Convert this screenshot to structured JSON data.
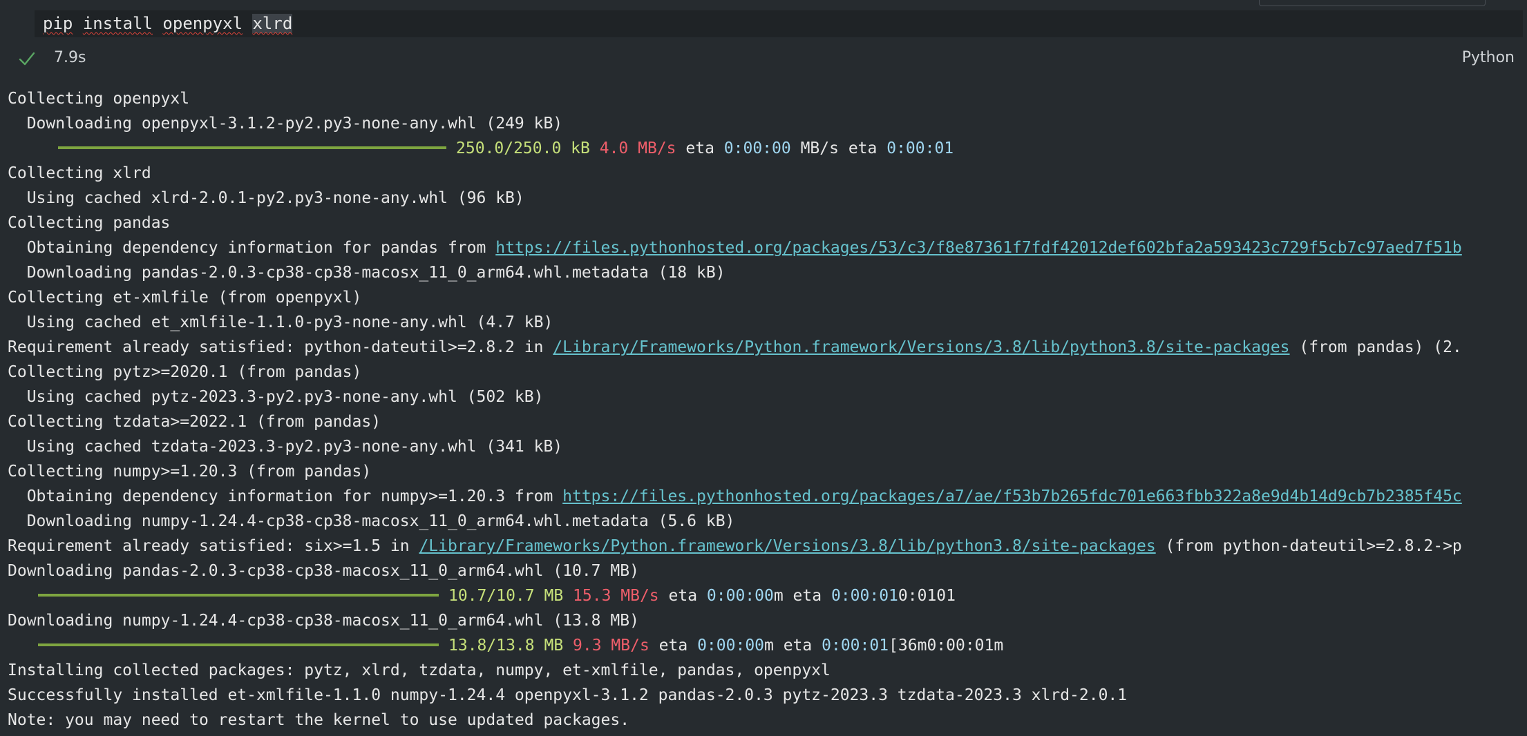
{
  "input": {
    "cmd": "pip",
    "sp": " ",
    "word1": "install",
    "word2": "openpyxl",
    "word3": "xlrd"
  },
  "status": {
    "elapsed": "7.9s",
    "language": "Python"
  },
  "output": {
    "l1": "Collecting openpyxl",
    "l2": "  Downloading openpyxl-3.1.2-py2.py3-none-any.whl (249 kB)",
    "p1": {
      "progress": "250.0/250.0 kB",
      "rate": "4.0 MB/s",
      "eta1": "eta",
      "time1": "0:00:00",
      "mid": "MB/s eta",
      "time2": "0:00:01"
    },
    "l4": "Collecting xlrd",
    "l5": "  Using cached xlrd-2.0.1-py2.py3-none-any.whl (96 kB)",
    "l6": "Collecting pandas",
    "l7_pre": "  Obtaining dependency information for pandas from ",
    "l7_link": "https://files.pythonhosted.org/packages/53/c3/f8e87361f7fdf42012def602bfa2a593423c729f5cb7c97aed7f51b",
    "l8": "  Downloading pandas-2.0.3-cp38-cp38-macosx_11_0_arm64.whl.metadata (18 kB)",
    "l9": "Collecting et-xmlfile (from openpyxl)",
    "l10": "  Using cached et_xmlfile-1.1.0-py3-none-any.whl (4.7 kB)",
    "l11_pre": "Requirement already satisfied: python-dateutil>=2.8.2 in ",
    "l11_link": "/Library/Frameworks/Python.framework/Versions/3.8/lib/python3.8/site-packages",
    "l11_post": " (from pandas) (2.",
    "l12": "Collecting pytz>=2020.1 (from pandas)",
    "l13": "  Using cached pytz-2023.3-py2.py3-none-any.whl (502 kB)",
    "l14": "Collecting tzdata>=2022.1 (from pandas)",
    "l15": "  Using cached tzdata-2023.3-py2.py3-none-any.whl (341 kB)",
    "l16": "Collecting numpy>=1.20.3 (from pandas)",
    "l17_pre": "  Obtaining dependency information for numpy>=1.20.3 from ",
    "l17_link": "https://files.pythonhosted.org/packages/a7/ae/f53b7b265fdc701e663fbb322a8e9d4b14d9cb7b2385f45c",
    "l18": "  Downloading numpy-1.24.4-cp38-cp38-macosx_11_0_arm64.whl.metadata (5.6 kB)",
    "l19_pre": "Requirement already satisfied: six>=1.5 in ",
    "l19_link": "/Library/Frameworks/Python.framework/Versions/3.8/lib/python3.8/site-packages",
    "l19_post": " (from python-dateutil>=2.8.2->p",
    "l20": "Downloading pandas-2.0.3-cp38-cp38-macosx_11_0_arm64.whl (10.7 MB)",
    "p2": {
      "progress": "10.7/10.7 MB",
      "rate": "15.3 MB/s",
      "eta1": "eta",
      "time1": "0:00:00",
      "mid": "m eta",
      "time2": "0:00:01",
      "tail": "0:0101"
    },
    "l22": "Downloading numpy-1.24.4-cp38-cp38-macosx_11_0_arm64.whl (13.8 MB)",
    "p3": {
      "progress": "13.8/13.8 MB",
      "rate": "9.3 MB/s",
      "eta1": "eta",
      "time1": "0:00:00",
      "mid": "m eta",
      "time2": "0:00:01",
      "tail": "[36m0:00:01m"
    },
    "l24": "Installing collected packages: pytz, xlrd, tzdata, numpy, et-xmlfile, pandas, openpyxl",
    "l25": "Successfully installed et-xmlfile-1.1.0 numpy-1.24.4 openpyxl-3.1.2 pandas-2.0.3 pytz-2023.3 tzdata-2023.3 xlrd-2.0.1",
    "l26": "Note: you may need to restart the kernel to use updated packages."
  },
  "colors": {
    "background": "#262b2f",
    "link": "#66c2cd",
    "progress_text": "#c6e07a",
    "rate": "#ee5e6a",
    "eta_time": "#9fd6f0",
    "progress_bar": "#7ea540",
    "success_check": "#5aa663"
  },
  "icons": {
    "status": "check-icon"
  }
}
